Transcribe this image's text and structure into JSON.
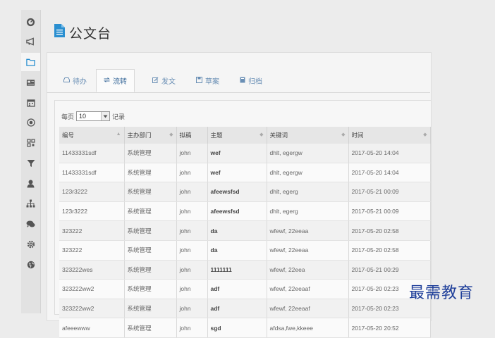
{
  "page": {
    "title": "公文台",
    "title_icon": "document-icon"
  },
  "sidebar": {
    "items": [
      {
        "icon": "dashboard-icon"
      },
      {
        "icon": "megaphone-icon"
      },
      {
        "icon": "folder-icon",
        "active": true
      },
      {
        "icon": "newspaper-icon"
      },
      {
        "icon": "calendar-icon"
      },
      {
        "icon": "target-icon"
      },
      {
        "icon": "qrcode-icon"
      },
      {
        "icon": "filter-icon"
      },
      {
        "icon": "user-icon"
      },
      {
        "icon": "sitemap-icon"
      },
      {
        "icon": "chat-icon"
      },
      {
        "icon": "gear-icon"
      },
      {
        "icon": "globe-icon"
      }
    ]
  },
  "tabs": [
    {
      "label": "待办",
      "icon": "inbox-icon"
    },
    {
      "label": "流转",
      "icon": "transfer-icon",
      "active": true
    },
    {
      "label": "发文",
      "icon": "edit-icon"
    },
    {
      "label": "草案",
      "icon": "draft-icon"
    },
    {
      "label": "归档",
      "icon": "archive-icon"
    }
  ],
  "list": {
    "per_page_label": "每页",
    "per_page_value": "10",
    "records_label": "记录"
  },
  "table": {
    "columns": [
      "编号",
      "主办部门",
      "拟稿",
      "主题",
      "关键词",
      "时间"
    ],
    "rows": [
      [
        "11433331sdf",
        "系统管理",
        "john",
        "wef",
        "dhlt, egergw",
        "2017-05-20 14:04"
      ],
      [
        "11433331sdf",
        "系统管理",
        "john",
        "wef",
        "dhlt, egergw",
        "2017-05-20 14:04"
      ],
      [
        "123r3222",
        "系统管理",
        "john",
        "afeewsfsd",
        "dhlt, egerg",
        "2017-05-21 00:09"
      ],
      [
        "123r3222",
        "系统管理",
        "john",
        "afeewsfsd",
        "dhlt, egerg",
        "2017-05-21 00:09"
      ],
      [
        "323222",
        "系统管理",
        "john",
        "da",
        "wfewf, 22eeaa",
        "2017-05-20 02:58"
      ],
      [
        "323222",
        "系统管理",
        "john",
        "da",
        "wfewf, 22eeaa",
        "2017-05-20 02:58"
      ],
      [
        "323222wes",
        "系统管理",
        "john",
        "1111111",
        "wfewf, 22eea",
        "2017-05-21 00:29"
      ],
      [
        "323222ww2",
        "系统管理",
        "john",
        "adf",
        "wfewf, 22eeaaf",
        "2017-05-20 02:23"
      ],
      [
        "323222ww2",
        "系统管理",
        "john",
        "adf",
        "wfewf, 22eeaaf",
        "2017-05-20 02:23"
      ],
      [
        "afeeewww",
        "系统管理",
        "john",
        "sgd",
        "afdsa,fwe,kkeee",
        "2017-05-20 20:52"
      ]
    ]
  },
  "watermark": "最需教育",
  "colors": {
    "accent": "#2a8fd0",
    "tab_text": "#6a8fb5",
    "watermark": "#1f3f9a"
  }
}
